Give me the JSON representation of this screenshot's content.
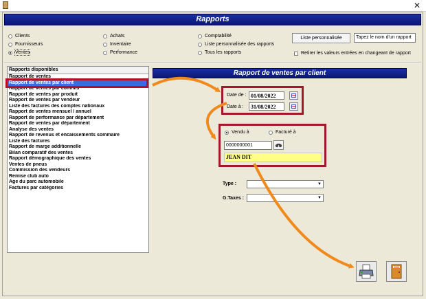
{
  "window": {
    "close_glyph": "✕"
  },
  "header": {
    "title": "Rapports"
  },
  "categories": [
    {
      "label": "Clients",
      "selected": false
    },
    {
      "label": "Fournisseurs",
      "selected": false
    },
    {
      "label": "Ventes",
      "selected": true
    },
    {
      "label": "Achats",
      "selected": false
    },
    {
      "label": "Inventaire",
      "selected": false
    },
    {
      "label": "Performance",
      "selected": false
    },
    {
      "label": "Comptabilité",
      "selected": false
    },
    {
      "label": "Liste personnalisée des rapports",
      "selected": false
    },
    {
      "label": "Tous les rapports",
      "selected": false
    }
  ],
  "custom_list_button": "Liste personnalisée",
  "report_name_field": {
    "value": "Tapez le nom d'un rapport"
  },
  "retain_values": {
    "label": "Retirer les valeurs entrées en changeant de rapport",
    "checked": false
  },
  "reports": {
    "header": "Rapports disponibles",
    "items": [
      "Rapport de ventes",
      "Rapport de ventes par client",
      "Rapport de ventes par commis",
      "Rapport de ventes par produit",
      "Rapport de ventes par vendeur",
      "Liste des factures des comptes nationaux",
      "Rapport de ventes mensuel / annuel",
      "Rapport de performance par département",
      "Rapport de ventes par département",
      "Analyse des ventes",
      "Rapport de revenus et encaissements sommaire",
      "Liste des factures",
      "Rapport de marge additionnelle",
      "Bilan comparatif des ventes",
      "Rapport démographique des ventes",
      "Ventes de pneus",
      "Commission des vendeurs",
      "Remise club auto",
      "Age du parc automobile",
      "Factures par catégories"
    ],
    "selected_index": 1
  },
  "panel": {
    "title": "Rapport de ventes par client",
    "date_from_label": "Date de :",
    "date_from": "01/08/2022",
    "date_to_label": "Date à :",
    "date_to": "31/08/2022",
    "sold_to_label": "Vendu à",
    "invoiced_to_label": "Facturé à",
    "client_number": "0000000001",
    "client_name": "JEAN DIT",
    "type_label": "Type :",
    "type_value": "",
    "gtaxes_label": "G.Taxes :",
    "gtaxes_value": ""
  },
  "colors": {
    "banner": "#0a1778",
    "highlight_frame": "#a0182a",
    "arrow": "#f08a1c",
    "client_name_bg": "#ffff88",
    "selection": "#3d6be0"
  }
}
